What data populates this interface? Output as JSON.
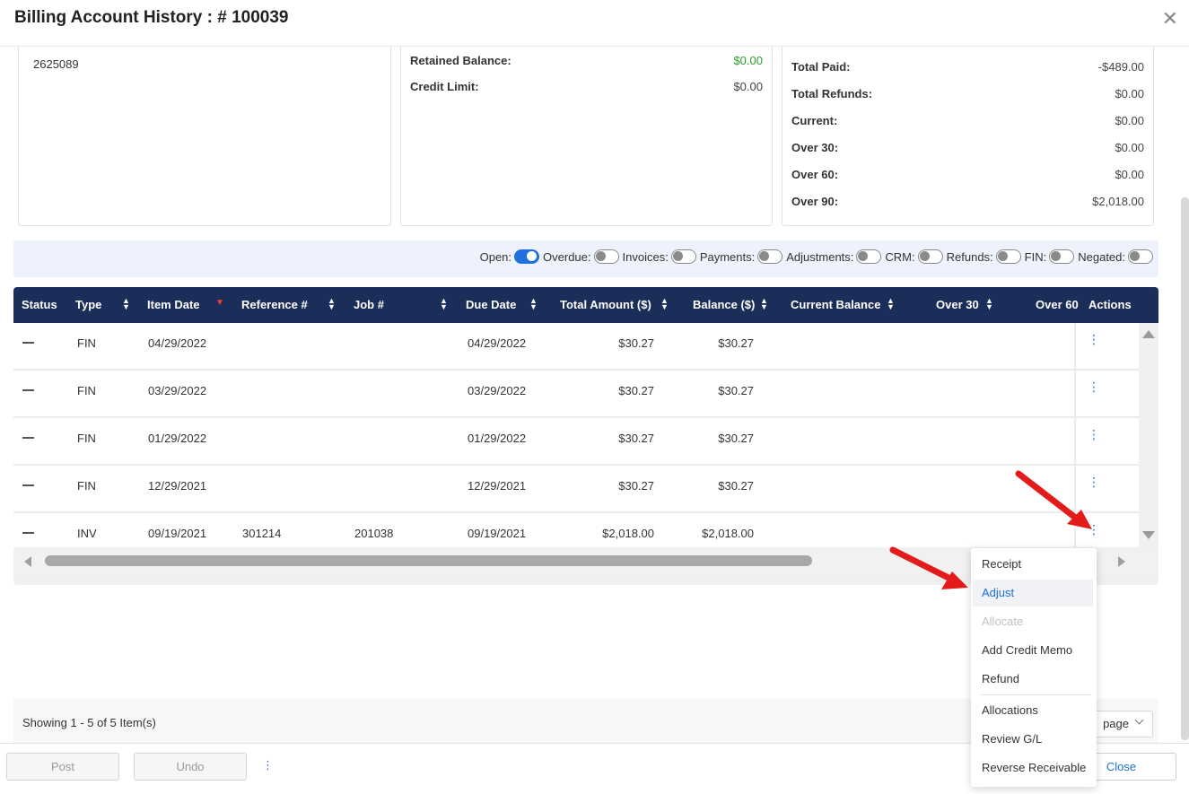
{
  "modal": {
    "title": "Billing Account History : # 100039",
    "close_glyph": "✕"
  },
  "card1": {
    "number": "2625089"
  },
  "card2": {
    "rows": [
      {
        "label": "Retained Balance:",
        "value": "$0.00",
        "color": "#2e9e2e"
      },
      {
        "label": "Credit Limit:",
        "value": "$0.00"
      }
    ]
  },
  "card3": {
    "rows": [
      {
        "label": "Total Paid:",
        "value": "-$489.00"
      },
      {
        "label": "Total Refunds:",
        "value": "$0.00"
      },
      {
        "label": "Current:",
        "value": "$0.00"
      },
      {
        "label": "Over 30:",
        "value": "$0.00"
      },
      {
        "label": "Over 60:",
        "value": "$0.00"
      },
      {
        "label": "Over 90:",
        "value": "$2,018.00"
      }
    ]
  },
  "filters": [
    {
      "label": "Open:",
      "on": true
    },
    {
      "label": "Overdue:",
      "on": false
    },
    {
      "label": "Invoices:",
      "on": false
    },
    {
      "label": "Payments:",
      "on": false
    },
    {
      "label": "Adjustments:",
      "on": false
    },
    {
      "label": "CRM:",
      "on": false
    },
    {
      "label": "Refunds:",
      "on": false
    },
    {
      "label": "FIN:",
      "on": false
    },
    {
      "label": "Negated:",
      "on": false
    }
  ],
  "table": {
    "columns": [
      "Status",
      "Type",
      "Item Date",
      "Reference #",
      "Job #",
      "Due Date",
      "Total Amount ($)",
      "Balance ($)",
      "Current Balance",
      "Over 30",
      "Over 60",
      "Actions"
    ],
    "rows": [
      {
        "type": "FIN",
        "item_date": "04/29/2022",
        "reference": "",
        "job": "",
        "due_date": "04/29/2022",
        "total": "$30.27",
        "balance": "$30.27"
      },
      {
        "type": "FIN",
        "item_date": "03/29/2022",
        "reference": "",
        "job": "",
        "due_date": "03/29/2022",
        "total": "$30.27",
        "balance": "$30.27"
      },
      {
        "type": "FIN",
        "item_date": "01/29/2022",
        "reference": "",
        "job": "",
        "due_date": "01/29/2022",
        "total": "$30.27",
        "balance": "$30.27"
      },
      {
        "type": "FIN",
        "item_date": "12/29/2021",
        "reference": "",
        "job": "",
        "due_date": "12/29/2021",
        "total": "$30.27",
        "balance": "$30.27"
      },
      {
        "type": "INV",
        "item_date": "09/19/2021",
        "reference": "301214",
        "job": "201038",
        "due_date": "09/19/2021",
        "total": "$2,018.00",
        "balance": "$2,018.00"
      }
    ],
    "kebab_glyph": "⋮"
  },
  "pager": {
    "text": "Showing 1 - 5 of 5 Item(s)",
    "per_page_label": "page"
  },
  "footer": {
    "post": "Post",
    "undo": "Undo",
    "kebab": "⋮",
    "close": "Close"
  },
  "menu": {
    "items": [
      {
        "label": "Receipt",
        "state": "normal"
      },
      {
        "label": "Adjust",
        "state": "active"
      },
      {
        "label": "Allocate",
        "state": "disabled"
      },
      {
        "label": "Add Credit Memo",
        "state": "normal"
      },
      {
        "label": "Refund",
        "state": "normal"
      },
      {
        "label": "Allocations",
        "state": "normal"
      },
      {
        "label": "Review G/L",
        "state": "normal"
      },
      {
        "label": "Reverse Receivable",
        "state": "normal"
      }
    ]
  },
  "colors": {
    "header_bg": "#1b2d59",
    "accent": "#1f6fde",
    "arrow": "#e31b1b",
    "filter_bg": "#eef2fc"
  }
}
